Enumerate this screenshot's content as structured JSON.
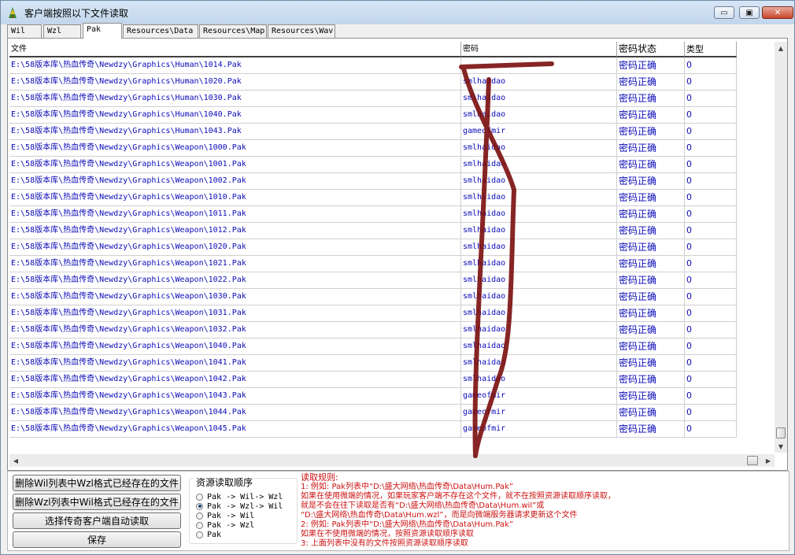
{
  "window": {
    "title": "客户端按照以下文件读取",
    "controls": {
      "minimize": "▭",
      "maximize": "▣",
      "close": "✕"
    }
  },
  "tabs": [
    {
      "label": "Wil"
    },
    {
      "label": "Wzl"
    },
    {
      "label": "Pak"
    },
    {
      "label": "Resources\\Data"
    },
    {
      "label": "Resources\\Map"
    },
    {
      "label": "Resources\\Wav"
    }
  ],
  "table": {
    "headers": [
      "文件",
      "密码",
      "密码状态",
      "类型"
    ],
    "rows": [
      [
        "E:\\58版本库\\热血传奇\\Newdzy\\Graphics\\Human\\1014.Pak",
        "",
        "密码正确",
        "0"
      ],
      [
        "E:\\58版本库\\热血传奇\\Newdzy\\Graphics\\Human\\1020.Pak",
        "smlhaidao",
        "密码正确",
        "0"
      ],
      [
        "E:\\58版本库\\热血传奇\\Newdzy\\Graphics\\Human\\1030.Pak",
        "smlhaidao",
        "密码正确",
        "0"
      ],
      [
        "E:\\58版本库\\热血传奇\\Newdzy\\Graphics\\Human\\1040.Pak",
        "smlhaidao",
        "密码正确",
        "0"
      ],
      [
        "E:\\58版本库\\热血传奇\\Newdzy\\Graphics\\Human\\1043.Pak",
        "gameofmir",
        "密码正确",
        "0"
      ],
      [
        "E:\\58版本库\\热血传奇\\Newdzy\\Graphics\\Weapon\\1000.Pak",
        "smlhaidao",
        "密码正确",
        "0"
      ],
      [
        "E:\\58版本库\\热血传奇\\Newdzy\\Graphics\\Weapon\\1001.Pak",
        "smlhaidao",
        "密码正确",
        "0"
      ],
      [
        "E:\\58版本库\\热血传奇\\Newdzy\\Graphics\\Weapon\\1002.Pak",
        "smlhaidao",
        "密码正确",
        "0"
      ],
      [
        "E:\\58版本库\\热血传奇\\Newdzy\\Graphics\\Weapon\\1010.Pak",
        "smlhaidao",
        "密码正确",
        "0"
      ],
      [
        "E:\\58版本库\\热血传奇\\Newdzy\\Graphics\\Weapon\\1011.Pak",
        "smlhaidao",
        "密码正确",
        "0"
      ],
      [
        "E:\\58版本库\\热血传奇\\Newdzy\\Graphics\\Weapon\\1012.Pak",
        "smlhaidao",
        "密码正确",
        "0"
      ],
      [
        "E:\\58版本库\\热血传奇\\Newdzy\\Graphics\\Weapon\\1020.Pak",
        "smlhaidao",
        "密码正确",
        "0"
      ],
      [
        "E:\\58版本库\\热血传奇\\Newdzy\\Graphics\\Weapon\\1021.Pak",
        "smlhaidao",
        "密码正确",
        "0"
      ],
      [
        "E:\\58版本库\\热血传奇\\Newdzy\\Graphics\\Weapon\\1022.Pak",
        "smlhaidao",
        "密码正确",
        "0"
      ],
      [
        "E:\\58版本库\\热血传奇\\Newdzy\\Graphics\\Weapon\\1030.Pak",
        "smlhaidao",
        "密码正确",
        "0"
      ],
      [
        "E:\\58版本库\\热血传奇\\Newdzy\\Graphics\\Weapon\\1031.Pak",
        "smlhaidao",
        "密码正确",
        "0"
      ],
      [
        "E:\\58版本库\\热血传奇\\Newdzy\\Graphics\\Weapon\\1032.Pak",
        "smlhaidao",
        "密码正确",
        "0"
      ],
      [
        "E:\\58版本库\\热血传奇\\Newdzy\\Graphics\\Weapon\\1040.Pak",
        "smlhaidao",
        "密码正确",
        "0"
      ],
      [
        "E:\\58版本库\\热血传奇\\Newdzy\\Graphics\\Weapon\\1041.Pak",
        "smlhaidao",
        "密码正确",
        "0"
      ],
      [
        "E:\\58版本库\\热血传奇\\Newdzy\\Graphics\\Weapon\\1042.Pak",
        "smlhaidao",
        "密码正确",
        "0"
      ],
      [
        "E:\\58版本库\\热血传奇\\Newdzy\\Graphics\\Weapon\\1043.Pak",
        "gameofmir",
        "密码正确",
        "0"
      ],
      [
        "E:\\58版本库\\热血传奇\\Newdzy\\Graphics\\Weapon\\1044.Pak",
        "gameofmir",
        "密码正确",
        "0"
      ],
      [
        "E:\\58版本库\\热血传奇\\Newdzy\\Graphics\\Weapon\\1045.Pak",
        "gameofmir",
        "密码正确",
        "0"
      ]
    ]
  },
  "scroll": {
    "up": "▲",
    "down": "▼",
    "left": "◀",
    "right": "▶"
  },
  "actions": [
    "删除Wil列表中Wzl格式已经存在的文件",
    "删除Wzl列表中Wil格式已经存在的文件",
    "选择传奇客户端自动读取",
    "保存"
  ],
  "read_order": {
    "title": "资源读取顺序",
    "selected_index": 1,
    "options": [
      "Pak -> Wil-> Wzl",
      "Pak -> Wzl-> Wil",
      "Pak -> Wil",
      "Pak -> Wzl",
      "Pak"
    ]
  },
  "rules": [
    "读取规则:",
    "1: 例如: Pak列表中“D:\\盛大网络\\热血传奇\\Data\\Hum.Pak”",
    "    如果在使用微端的情况，如果玩家客户端不存在这个文件，就不在按照资源读取顺序读取，",
    "    就是不会在往下读取是否有“D:\\盛大网络\\热血传奇\\Data\\Hum.wil”或",
    "    “D:\\盛大网络\\热血传奇\\Data\\Hum.wzl”，而是向微端服务器请求更新这个文件",
    "2: 例如: Pak列表中“D:\\盛大网络\\热血传奇\\Data\\Hum.Pak”",
    "    如果在不使用微端的情况，按照资源读取顺序读取",
    "3: 上面列表中没有的文件按照资源读取顺序读取"
  ],
  "colors": {
    "link_text": "#0b0bb8",
    "rule_text": "#cc1212",
    "ink": "#7a0d0d"
  }
}
